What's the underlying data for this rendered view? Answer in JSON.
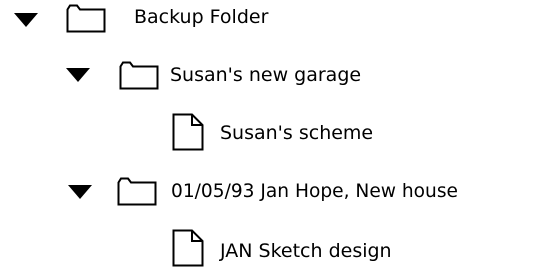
{
  "tree": {
    "items": [
      {
        "label": "Backup Folder",
        "type": "folder",
        "expanded": true,
        "icon": "folder-icon",
        "disclosure": "triangle-down-icon"
      },
      {
        "label": "Susan's new garage",
        "type": "folder",
        "expanded": true,
        "icon": "folder-icon",
        "disclosure": "triangle-down-icon"
      },
      {
        "label": "Susan's scheme",
        "type": "document",
        "icon": "document-icon"
      },
      {
        "label": "01/05/93 Jan Hope, New house",
        "type": "folder",
        "expanded": true,
        "icon": "folder-icon",
        "disclosure": "triangle-down-icon"
      },
      {
        "label": "JAN Sketch design",
        "type": "document",
        "icon": "document-icon"
      }
    ]
  },
  "colors": {
    "background": "#ffffff",
    "foreground": "#000000"
  }
}
